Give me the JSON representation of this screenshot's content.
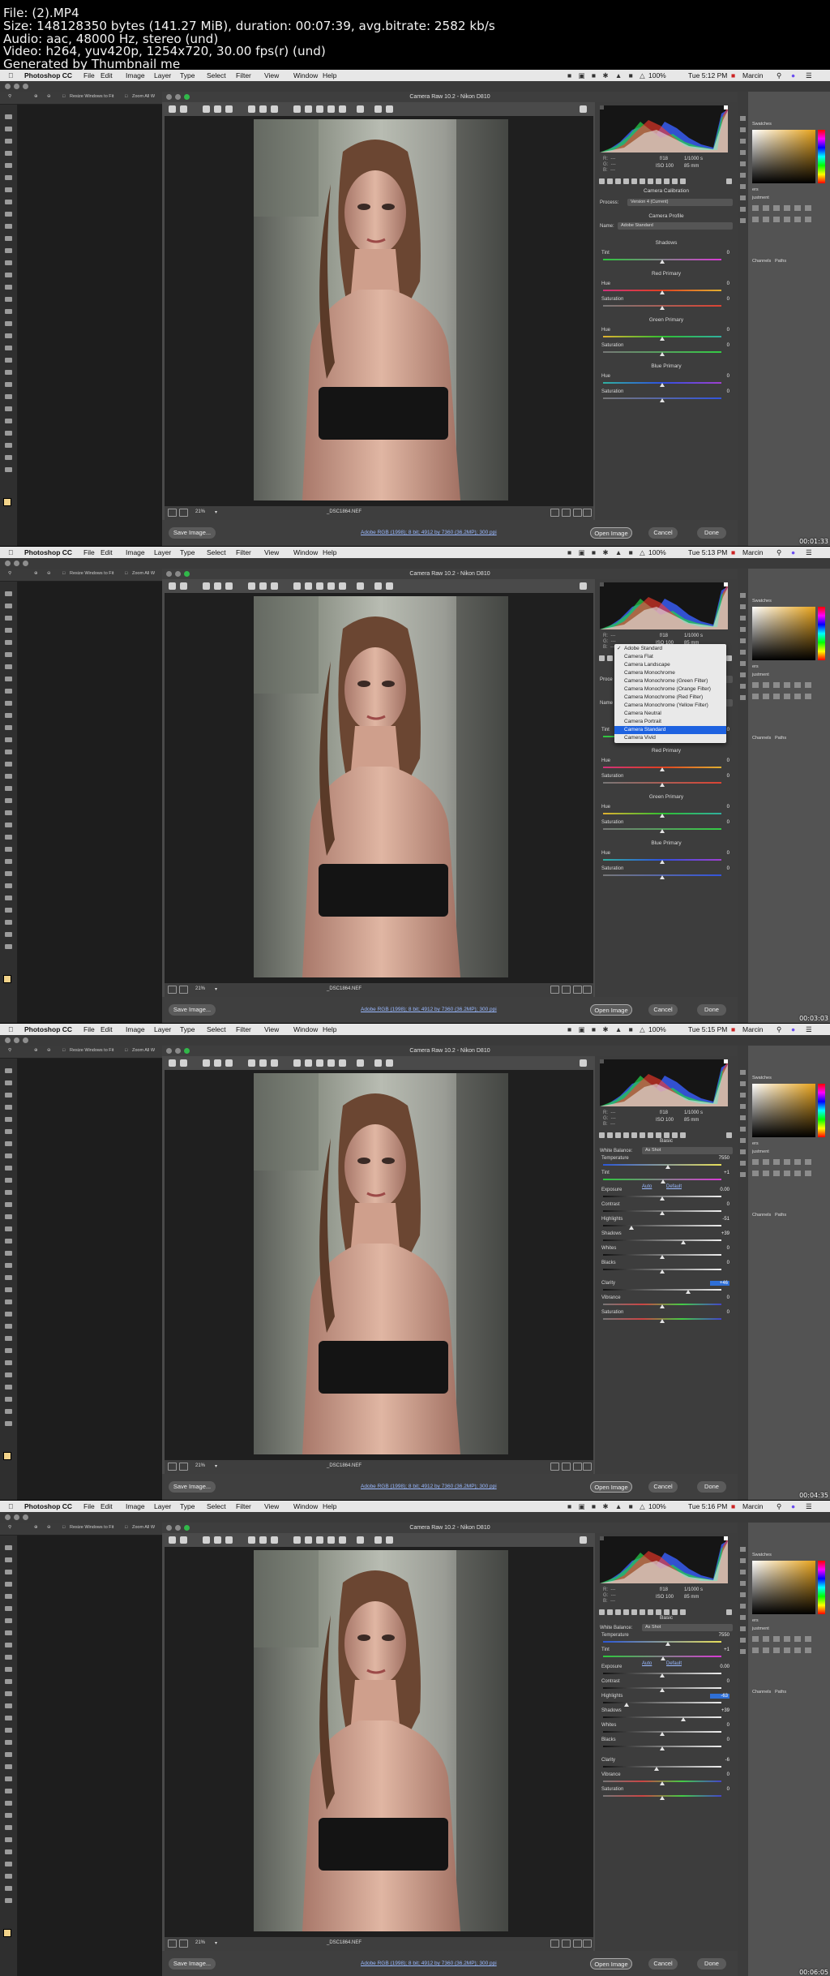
{
  "header": {
    "lines": [
      "File:  (2).MP4",
      "Size: 148128350 bytes (141.27 MiB), duration: 00:07:39, avg.bitrate: 2582 kb/s",
      "Audio: aac, 48000 Hz, stereo (und)",
      "Video: h264, yuv420p, 1254x720, 30.00 fps(r) (und)",
      "Generated by Thumbnail me"
    ]
  },
  "menubar": {
    "items": [
      "Photoshop CC",
      "File",
      "Edit",
      "Image",
      "Layer",
      "Type",
      "Select",
      "Filter",
      "View",
      "Window",
      "Help"
    ],
    "user": "Marcin",
    "battery": "100%"
  },
  "options": {
    "resize": "Resize Windows to Fit",
    "zoom_all": "Zoom All W"
  },
  "dialog": {
    "title": "Camera Raw 10.2  -  Nikon D810",
    "zoom": "21%",
    "filename": "_DSC1864.NEF",
    "workflow": "Adobe RGB (1998); 8 bit; 4912 by 7360 (36.2MP); 300 ppi",
    "save": "Save Image...",
    "open": "Open Image",
    "cancel": "Cancel",
    "done": "Done",
    "meta": {
      "aperture": "f/18",
      "shutter": "1/1000 s",
      "iso": "ISO 100",
      "focal": "85 mm"
    }
  },
  "rightcol": {
    "swatches": "Swatches",
    "adjust": "justment",
    "ers": "ers",
    "channels": "Channels",
    "paths": "Paths"
  },
  "frames": [
    {
      "time": "Tue 5:12 PM",
      "timestamp": "00:01:33",
      "panel": "calibration",
      "calibration": {
        "title": "Camera Calibration",
        "process_label": "Process:",
        "process": "Version 4 (Current)",
        "profile_title": "Camera Profile",
        "name_label": "Name:",
        "name": "Adobe Standard",
        "sections": [
          {
            "title": "Shadows",
            "rows": [
              {
                "label": "Tint",
                "value": "0"
              }
            ]
          },
          {
            "title": "Red Primary",
            "rows": [
              {
                "label": "Hue",
                "value": "0"
              },
              {
                "label": "Saturation",
                "value": "0"
              }
            ]
          },
          {
            "title": "Green Primary",
            "rows": [
              {
                "label": "Hue",
                "value": "0"
              },
              {
                "label": "Saturation",
                "value": "0"
              }
            ]
          },
          {
            "title": "Blue Primary",
            "rows": [
              {
                "label": "Hue",
                "value": "0"
              },
              {
                "label": "Saturation",
                "value": "0"
              }
            ]
          }
        ]
      }
    },
    {
      "time": "Tue 5:13 PM",
      "timestamp": "00:03:03",
      "panel": "calibration-dropdown",
      "calibration": {
        "title": "",
        "process_label": "Proce",
        "process": "",
        "profile_title": "",
        "name_label": "Name",
        "name": "",
        "sections": [
          {
            "title": "",
            "rows": [
              {
                "label": "Tint",
                "value": "0"
              }
            ]
          },
          {
            "title": "Red Primary",
            "rows": [
              {
                "label": "Hue",
                "value": "0"
              },
              {
                "label": "Saturation",
                "value": "0"
              }
            ]
          },
          {
            "title": "Green Primary",
            "rows": [
              {
                "label": "Hue",
                "value": "0"
              },
              {
                "label": "Saturation",
                "value": "0"
              }
            ]
          },
          {
            "title": "Blue Primary",
            "rows": [
              {
                "label": "Hue",
                "value": "0"
              },
              {
                "label": "Saturation",
                "value": "0"
              }
            ]
          }
        ]
      },
      "dropdown": {
        "checked": "Adobe Standard",
        "items": [
          "Adobe Standard",
          "Camera Flat",
          "Camera Landscape",
          "Camera Monochrome",
          "Camera Monochrome (Green Filter)",
          "Camera Monochrome (Orange Filter)",
          "Camera Monochrome (Red Filter)",
          "Camera Monochrome (Yellow Filter)",
          "Camera Neutral",
          "Camera Portrait",
          "Camera Standard",
          "Camera Vivid"
        ],
        "highlighted": "Camera Standard"
      }
    },
    {
      "time": "Tue 5:15 PM",
      "timestamp": "00:04:35",
      "panel": "basic",
      "basic": {
        "title": "Basic",
        "wb_label": "White Balance:",
        "wb": "As Shot",
        "auto": "Auto",
        "default": "Default",
        "rows": [
          {
            "label": "Temperature",
            "value": "7550"
          },
          {
            "label": "Tint",
            "value": "+1"
          },
          {
            "label": "Exposure",
            "value": "0.00"
          },
          {
            "label": "Contrast",
            "value": "0"
          },
          {
            "label": "Highlights",
            "value": "-51"
          },
          {
            "label": "Shadows",
            "value": "+39"
          },
          {
            "label": "Whites",
            "value": "0"
          },
          {
            "label": "Blacks",
            "value": "0"
          },
          {
            "label": "Clarity",
            "value": "+46",
            "hl": true
          },
          {
            "label": "Vibrance",
            "value": "0"
          },
          {
            "label": "Saturation",
            "value": "0"
          }
        ]
      }
    },
    {
      "time": "Tue 5:16 PM",
      "timestamp": "00:06:05",
      "panel": "basic",
      "basic": {
        "title": "Basic",
        "wb_label": "White Balance:",
        "wb": "As Shot",
        "auto": "Auto",
        "default": "Default",
        "rows": [
          {
            "label": "Temperature",
            "value": "7550"
          },
          {
            "label": "Tint",
            "value": "+1"
          },
          {
            "label": "Exposure",
            "value": "0.00"
          },
          {
            "label": "Contrast",
            "value": "0"
          },
          {
            "label": "Highlights",
            "value": "-63",
            "hl": true
          },
          {
            "label": "Shadows",
            "value": "+39"
          },
          {
            "label": "Whites",
            "value": "0"
          },
          {
            "label": "Blacks",
            "value": "0"
          },
          {
            "label": "Clarity",
            "value": "-6"
          },
          {
            "label": "Vibrance",
            "value": "0"
          },
          {
            "label": "Saturation",
            "value": "0"
          }
        ]
      }
    }
  ],
  "colors": {
    "accent": "#1e62e0",
    "highlight": "#2f6fd6",
    "link": "#9ab9ff"
  }
}
